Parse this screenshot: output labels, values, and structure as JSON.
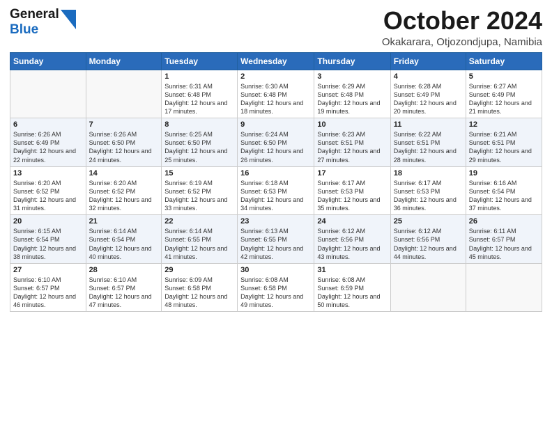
{
  "logo": {
    "general": "General",
    "blue": "Blue"
  },
  "title": "October 2024",
  "location": "Okakarara, Otjozondjupa, Namibia",
  "days_of_week": [
    "Sunday",
    "Monday",
    "Tuesday",
    "Wednesday",
    "Thursday",
    "Friday",
    "Saturday"
  ],
  "weeks": [
    [
      {
        "day": "",
        "sunrise": "",
        "sunset": "",
        "daylight": ""
      },
      {
        "day": "",
        "sunrise": "",
        "sunset": "",
        "daylight": ""
      },
      {
        "day": "1",
        "sunrise": "Sunrise: 6:31 AM",
        "sunset": "Sunset: 6:48 PM",
        "daylight": "Daylight: 12 hours and 17 minutes."
      },
      {
        "day": "2",
        "sunrise": "Sunrise: 6:30 AM",
        "sunset": "Sunset: 6:48 PM",
        "daylight": "Daylight: 12 hours and 18 minutes."
      },
      {
        "day": "3",
        "sunrise": "Sunrise: 6:29 AM",
        "sunset": "Sunset: 6:48 PM",
        "daylight": "Daylight: 12 hours and 19 minutes."
      },
      {
        "day": "4",
        "sunrise": "Sunrise: 6:28 AM",
        "sunset": "Sunset: 6:49 PM",
        "daylight": "Daylight: 12 hours and 20 minutes."
      },
      {
        "day": "5",
        "sunrise": "Sunrise: 6:27 AM",
        "sunset": "Sunset: 6:49 PM",
        "daylight": "Daylight: 12 hours and 21 minutes."
      }
    ],
    [
      {
        "day": "6",
        "sunrise": "Sunrise: 6:26 AM",
        "sunset": "Sunset: 6:49 PM",
        "daylight": "Daylight: 12 hours and 22 minutes."
      },
      {
        "day": "7",
        "sunrise": "Sunrise: 6:26 AM",
        "sunset": "Sunset: 6:50 PM",
        "daylight": "Daylight: 12 hours and 24 minutes."
      },
      {
        "day": "8",
        "sunrise": "Sunrise: 6:25 AM",
        "sunset": "Sunset: 6:50 PM",
        "daylight": "Daylight: 12 hours and 25 minutes."
      },
      {
        "day": "9",
        "sunrise": "Sunrise: 6:24 AM",
        "sunset": "Sunset: 6:50 PM",
        "daylight": "Daylight: 12 hours and 26 minutes."
      },
      {
        "day": "10",
        "sunrise": "Sunrise: 6:23 AM",
        "sunset": "Sunset: 6:51 PM",
        "daylight": "Daylight: 12 hours and 27 minutes."
      },
      {
        "day": "11",
        "sunrise": "Sunrise: 6:22 AM",
        "sunset": "Sunset: 6:51 PM",
        "daylight": "Daylight: 12 hours and 28 minutes."
      },
      {
        "day": "12",
        "sunrise": "Sunrise: 6:21 AM",
        "sunset": "Sunset: 6:51 PM",
        "daylight": "Daylight: 12 hours and 29 minutes."
      }
    ],
    [
      {
        "day": "13",
        "sunrise": "Sunrise: 6:20 AM",
        "sunset": "Sunset: 6:52 PM",
        "daylight": "Daylight: 12 hours and 31 minutes."
      },
      {
        "day": "14",
        "sunrise": "Sunrise: 6:20 AM",
        "sunset": "Sunset: 6:52 PM",
        "daylight": "Daylight: 12 hours and 32 minutes."
      },
      {
        "day": "15",
        "sunrise": "Sunrise: 6:19 AM",
        "sunset": "Sunset: 6:52 PM",
        "daylight": "Daylight: 12 hours and 33 minutes."
      },
      {
        "day": "16",
        "sunrise": "Sunrise: 6:18 AM",
        "sunset": "Sunset: 6:53 PM",
        "daylight": "Daylight: 12 hours and 34 minutes."
      },
      {
        "day": "17",
        "sunrise": "Sunrise: 6:17 AM",
        "sunset": "Sunset: 6:53 PM",
        "daylight": "Daylight: 12 hours and 35 minutes."
      },
      {
        "day": "18",
        "sunrise": "Sunrise: 6:17 AM",
        "sunset": "Sunset: 6:53 PM",
        "daylight": "Daylight: 12 hours and 36 minutes."
      },
      {
        "day": "19",
        "sunrise": "Sunrise: 6:16 AM",
        "sunset": "Sunset: 6:54 PM",
        "daylight": "Daylight: 12 hours and 37 minutes."
      }
    ],
    [
      {
        "day": "20",
        "sunrise": "Sunrise: 6:15 AM",
        "sunset": "Sunset: 6:54 PM",
        "daylight": "Daylight: 12 hours and 38 minutes."
      },
      {
        "day": "21",
        "sunrise": "Sunrise: 6:14 AM",
        "sunset": "Sunset: 6:54 PM",
        "daylight": "Daylight: 12 hours and 40 minutes."
      },
      {
        "day": "22",
        "sunrise": "Sunrise: 6:14 AM",
        "sunset": "Sunset: 6:55 PM",
        "daylight": "Daylight: 12 hours and 41 minutes."
      },
      {
        "day": "23",
        "sunrise": "Sunrise: 6:13 AM",
        "sunset": "Sunset: 6:55 PM",
        "daylight": "Daylight: 12 hours and 42 minutes."
      },
      {
        "day": "24",
        "sunrise": "Sunrise: 6:12 AM",
        "sunset": "Sunset: 6:56 PM",
        "daylight": "Daylight: 12 hours and 43 minutes."
      },
      {
        "day": "25",
        "sunrise": "Sunrise: 6:12 AM",
        "sunset": "Sunset: 6:56 PM",
        "daylight": "Daylight: 12 hours and 44 minutes."
      },
      {
        "day": "26",
        "sunrise": "Sunrise: 6:11 AM",
        "sunset": "Sunset: 6:57 PM",
        "daylight": "Daylight: 12 hours and 45 minutes."
      }
    ],
    [
      {
        "day": "27",
        "sunrise": "Sunrise: 6:10 AM",
        "sunset": "Sunset: 6:57 PM",
        "daylight": "Daylight: 12 hours and 46 minutes."
      },
      {
        "day": "28",
        "sunrise": "Sunrise: 6:10 AM",
        "sunset": "Sunset: 6:57 PM",
        "daylight": "Daylight: 12 hours and 47 minutes."
      },
      {
        "day": "29",
        "sunrise": "Sunrise: 6:09 AM",
        "sunset": "Sunset: 6:58 PM",
        "daylight": "Daylight: 12 hours and 48 minutes."
      },
      {
        "day": "30",
        "sunrise": "Sunrise: 6:08 AM",
        "sunset": "Sunset: 6:58 PM",
        "daylight": "Daylight: 12 hours and 49 minutes."
      },
      {
        "day": "31",
        "sunrise": "Sunrise: 6:08 AM",
        "sunset": "Sunset: 6:59 PM",
        "daylight": "Daylight: 12 hours and 50 minutes."
      },
      {
        "day": "",
        "sunrise": "",
        "sunset": "",
        "daylight": ""
      },
      {
        "day": "",
        "sunrise": "",
        "sunset": "",
        "daylight": ""
      }
    ]
  ]
}
